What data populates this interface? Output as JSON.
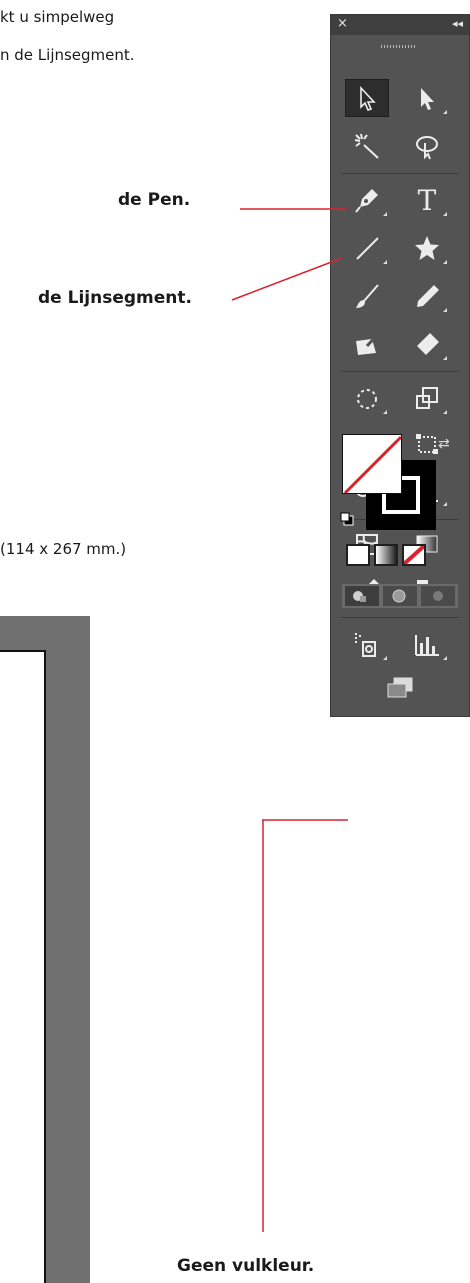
{
  "intro": {
    "line1": "kt u simpelweg",
    "line2": "n de Lijnsegment."
  },
  "callouts": {
    "pen": "de Pen.",
    "line_segment": "de Lijnsegment.",
    "no_fill": "Geen vulkleur."
  },
  "dimensions": "(114 x 267 mm.)",
  "panel": {
    "close_glyph": "×",
    "collapse_glyph": "◂◂",
    "type_tool_glyph": "T",
    "swap_glyph": "⇄"
  },
  "colors": {
    "accent_red": "#d9232e",
    "panel_bg": "#535353",
    "canvas_gray": "#707070"
  }
}
